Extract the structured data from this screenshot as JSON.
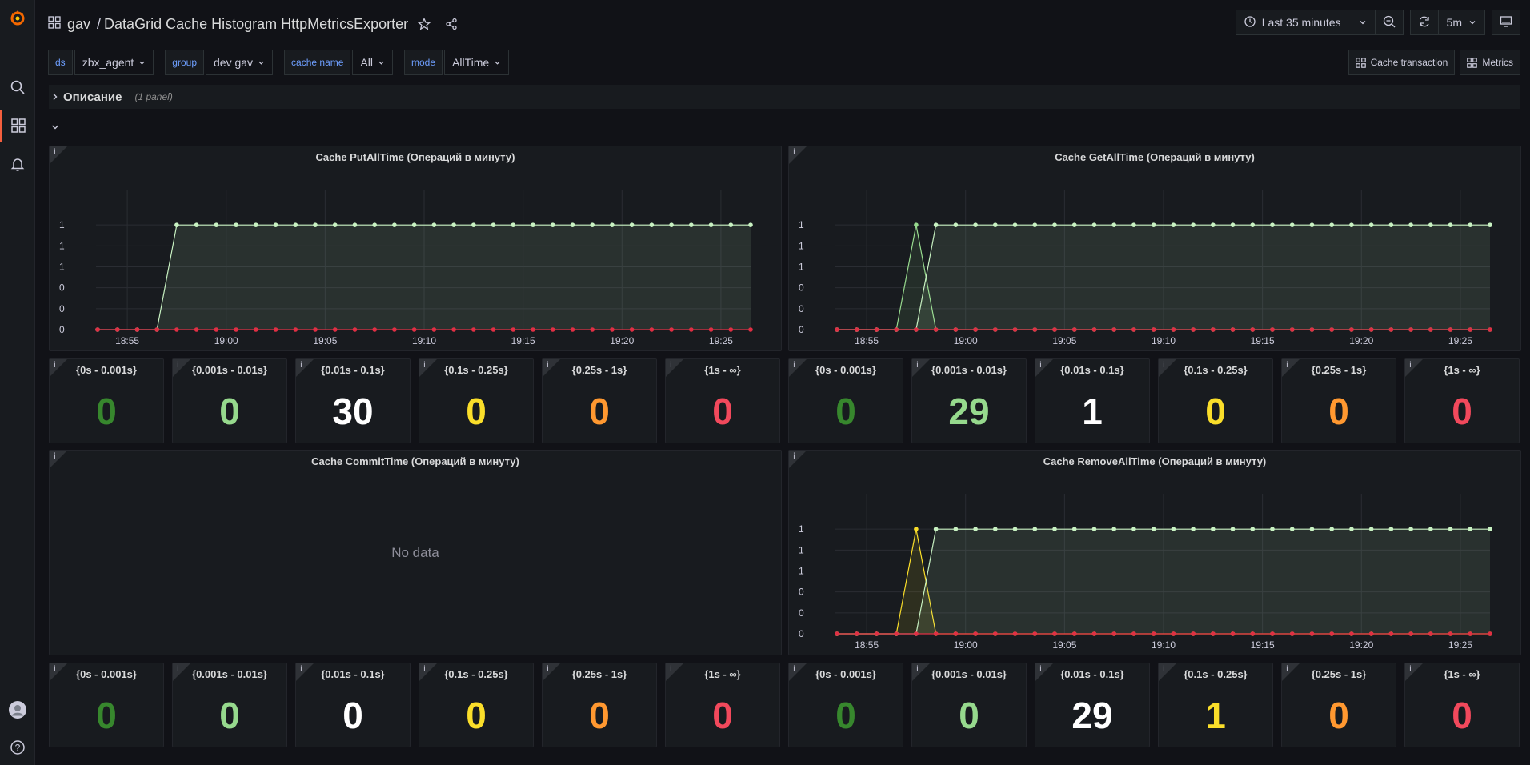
{
  "breadcrumb": {
    "folder": "gav",
    "separator": "/",
    "title": "DataGrid Cache Histogram HttpMetricsExporter"
  },
  "toolbar": {
    "time_range": "Last 35 minutes",
    "refresh_interval": "5m"
  },
  "variables": [
    {
      "label": "ds",
      "value": "zbx_agent"
    },
    {
      "label": "group",
      "value": "dev gav"
    },
    {
      "label": "cache name",
      "value": "All"
    },
    {
      "label": "mode",
      "value": "AllTime"
    }
  ],
  "links": [
    "Cache transaction",
    "Metrics"
  ],
  "rows": {
    "description_title": "Описание",
    "description_count": "(1 panel)"
  },
  "colors": {
    "dark_green": "#37872d",
    "light_green": "#96d98d",
    "white": "#ffffff",
    "yellow": "#fade2a",
    "orange": "#ff9830",
    "red": "#f2495c",
    "line_green": "#c8f2c2",
    "line_red": "#e02f44"
  },
  "bucket_labels": [
    "{0s - 0.001s}",
    "{0.001s - 0.01s}",
    "{0.01s - 0.1s}",
    "{0.1s - 0.25s}",
    "{0.25s - 1s}",
    "{1s - ∞}"
  ],
  "panels": {
    "put": {
      "title": "Cache PutAllTime (Операций в минуту)",
      "stats": [
        "0",
        "0",
        "30",
        "0",
        "0",
        "0"
      ]
    },
    "get": {
      "title": "Cache GetAllTime (Операций в минуту)",
      "stats": [
        "0",
        "29",
        "1",
        "0",
        "0",
        "0"
      ]
    },
    "commit": {
      "title": "Cache CommitTime (Операций в минуту)",
      "no_data": "No data",
      "stats": [
        "0",
        "0",
        "0",
        "0",
        "0",
        "0"
      ]
    },
    "remove": {
      "title": "Cache RemoveAllTime (Операций в минуту)",
      "stats": [
        "0",
        "0",
        "29",
        "1",
        "0",
        "0"
      ]
    }
  },
  "chart_data": [
    {
      "type": "line",
      "title": "Cache PutAllTime (Операций в минуту)",
      "x_ticks": [
        "18:55",
        "19:00",
        "19:05",
        "19:10",
        "19:15",
        "19:20",
        "19:25"
      ],
      "y_ticks": [
        "0",
        "0",
        "0",
        "1",
        "1",
        "1"
      ],
      "series": [
        {
          "color": "#c8f2c2",
          "values": [
            0,
            0,
            0,
            0,
            1,
            1,
            1,
            1,
            1,
            1,
            1,
            1,
            1,
            1,
            1,
            1,
            1,
            1,
            1,
            1,
            1,
            1,
            1,
            1,
            1,
            1,
            1,
            1,
            1,
            1,
            1,
            1,
            1,
            1
          ]
        },
        {
          "color": "#e02f44",
          "values": [
            0,
            0,
            0,
            0,
            0,
            0,
            0,
            0,
            0,
            0,
            0,
            0,
            0,
            0,
            0,
            0,
            0,
            0,
            0,
            0,
            0,
            0,
            0,
            0,
            0,
            0,
            0,
            0,
            0,
            0,
            0,
            0,
            0,
            0
          ]
        }
      ]
    },
    {
      "type": "line",
      "title": "Cache GetAllTime (Операций в минуту)",
      "x_ticks": [
        "18:55",
        "19:00",
        "19:05",
        "19:10",
        "19:15",
        "19:20",
        "19:25"
      ],
      "y_ticks": [
        "0",
        "0",
        "0",
        "1",
        "1",
        "1"
      ],
      "series": [
        {
          "color": "#96d98d",
          "values": [
            0,
            0,
            0,
            0,
            1,
            0,
            0,
            0,
            0,
            0,
            0,
            0,
            0,
            0,
            0,
            0,
            0,
            0,
            0,
            0,
            0,
            0,
            0,
            0,
            0,
            0,
            0,
            0,
            0,
            0,
            0,
            0,
            0,
            0
          ]
        },
        {
          "color": "#c8f2c2",
          "values": [
            0,
            0,
            0,
            0,
            0,
            1,
            1,
            1,
            1,
            1,
            1,
            1,
            1,
            1,
            1,
            1,
            1,
            1,
            1,
            1,
            1,
            1,
            1,
            1,
            1,
            1,
            1,
            1,
            1,
            1,
            1,
            1,
            1,
            1
          ]
        },
        {
          "color": "#e02f44",
          "values": [
            0,
            0,
            0,
            0,
            0,
            0,
            0,
            0,
            0,
            0,
            0,
            0,
            0,
            0,
            0,
            0,
            0,
            0,
            0,
            0,
            0,
            0,
            0,
            0,
            0,
            0,
            0,
            0,
            0,
            0,
            0,
            0,
            0,
            0
          ]
        }
      ]
    },
    {
      "type": "line",
      "title": "Cache RemoveAllTime (Операций в минуту)",
      "x_ticks": [
        "18:55",
        "19:00",
        "19:05",
        "19:10",
        "19:15",
        "19:20",
        "19:25"
      ],
      "y_ticks": [
        "0",
        "0",
        "0",
        "1",
        "1",
        "1"
      ],
      "series": [
        {
          "color": "#fade2a",
          "values": [
            0,
            0,
            0,
            0,
            1,
            0,
            0,
            0,
            0,
            0,
            0,
            0,
            0,
            0,
            0,
            0,
            0,
            0,
            0,
            0,
            0,
            0,
            0,
            0,
            0,
            0,
            0,
            0,
            0,
            0,
            0,
            0,
            0,
            0
          ]
        },
        {
          "color": "#c8f2c2",
          "values": [
            0,
            0,
            0,
            0,
            0,
            1,
            1,
            1,
            1,
            1,
            1,
            1,
            1,
            1,
            1,
            1,
            1,
            1,
            1,
            1,
            1,
            1,
            1,
            1,
            1,
            1,
            1,
            1,
            1,
            1,
            1,
            1,
            1,
            1
          ]
        },
        {
          "color": "#e02f44",
          "values": [
            0,
            0,
            0,
            0,
            0,
            0,
            0,
            0,
            0,
            0,
            0,
            0,
            0,
            0,
            0,
            0,
            0,
            0,
            0,
            0,
            0,
            0,
            0,
            0,
            0,
            0,
            0,
            0,
            0,
            0,
            0,
            0,
            0,
            0
          ]
        }
      ]
    }
  ]
}
